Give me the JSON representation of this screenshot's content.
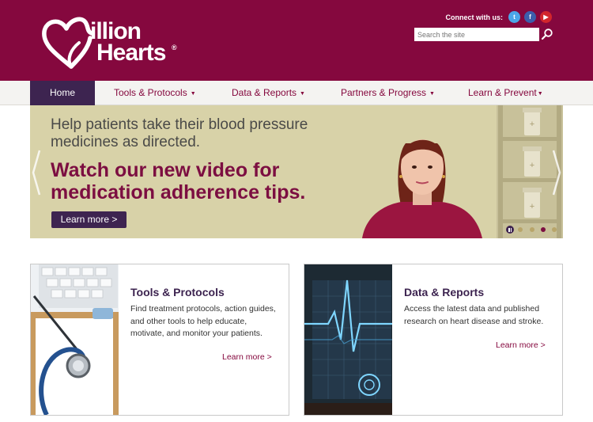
{
  "header": {
    "logo_word1": "illion",
    "logo_word2": "Hearts",
    "logo_reg": "®",
    "connect_label": "Connect with us:",
    "social": [
      {
        "name": "twitter",
        "glyph": "t",
        "color": "#4ba6e8"
      },
      {
        "name": "facebook",
        "glyph": "f",
        "color": "#3b5eac"
      },
      {
        "name": "youtube",
        "glyph": "▶",
        "color": "#d2262c"
      }
    ],
    "search_placeholder": "Search the site",
    "brand_color": "#85083e"
  },
  "nav": {
    "items": [
      {
        "label": "Home",
        "active": true
      },
      {
        "label": "Tools & Protocols",
        "caret": "▼"
      },
      {
        "label": "Data & Reports",
        "caret": "▼"
      },
      {
        "label": "Partners & Progress",
        "caret": "▼"
      },
      {
        "label": "Learn & Prevent",
        "caret": "▼"
      }
    ]
  },
  "hero": {
    "subtitle": "Help patients take their blood pressure medicines as directed.",
    "title": "Watch our new video for medication adherence tips.",
    "button": "Learn more >",
    "slides": 4,
    "active_slide": 3
  },
  "cards": [
    {
      "title": "Tools & Protocols",
      "description": "Find treatment protocols, action guides, and other tools to help educate, motivate, and monitor your patients.",
      "link": "Learn more >"
    },
    {
      "title": "Data & Reports",
      "description": "Access the latest data and published research on heart disease and stroke.",
      "link": "Learn more >"
    }
  ]
}
